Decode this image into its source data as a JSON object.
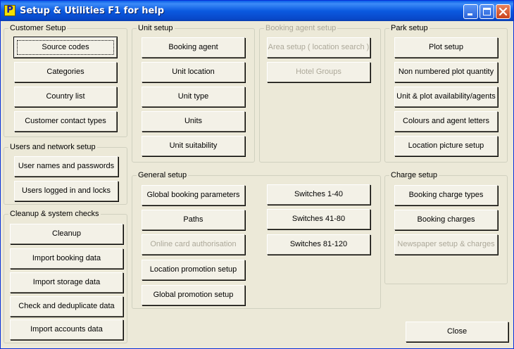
{
  "window": {
    "title": "Setup & Utilities F1 for help",
    "app_icon_letter": "P"
  },
  "customer_setup": {
    "title": "Customer Setup",
    "buttons": [
      "Source codes",
      "Categories",
      "Country list",
      "Customer contact types"
    ]
  },
  "users_network": {
    "title": "Users and network setup",
    "buttons": [
      "User names and passwords",
      "Users logged in and locks"
    ]
  },
  "cleanup": {
    "title": "Cleanup & system checks",
    "buttons": [
      "Cleanup",
      "Import booking data",
      "Import storage data",
      "Check and deduplicate data",
      "Import accounts data"
    ]
  },
  "unit_setup": {
    "title": "Unit setup",
    "buttons": [
      "Booking agent",
      "Unit location",
      "Unit type",
      "Units",
      "Unit suitability"
    ]
  },
  "booking_agent_setup": {
    "title": "Booking agent setup",
    "buttons": [
      "Area setup ( location search )",
      "Hotel Groups"
    ]
  },
  "park_setup": {
    "title": "Park setup",
    "buttons": [
      "Plot setup",
      "Non numbered plot quantity",
      "Unit & plot availability/agents",
      "Colours and agent letters",
      "Location picture setup"
    ]
  },
  "general_setup": {
    "title": "General setup",
    "buttons": [
      "Global booking parameters",
      "Paths",
      "Online card authorisation",
      "Location promotion setup",
      "Global promotion setup"
    ],
    "switches": [
      "Switches 1-40",
      "Switches 41-80",
      "Switches 81-120"
    ]
  },
  "charge_setup": {
    "title": "Charge setup",
    "buttons": [
      "Booking charge types",
      "Booking charges",
      "Newspaper setup & charges"
    ]
  },
  "footer": {
    "close_label": "Close"
  }
}
